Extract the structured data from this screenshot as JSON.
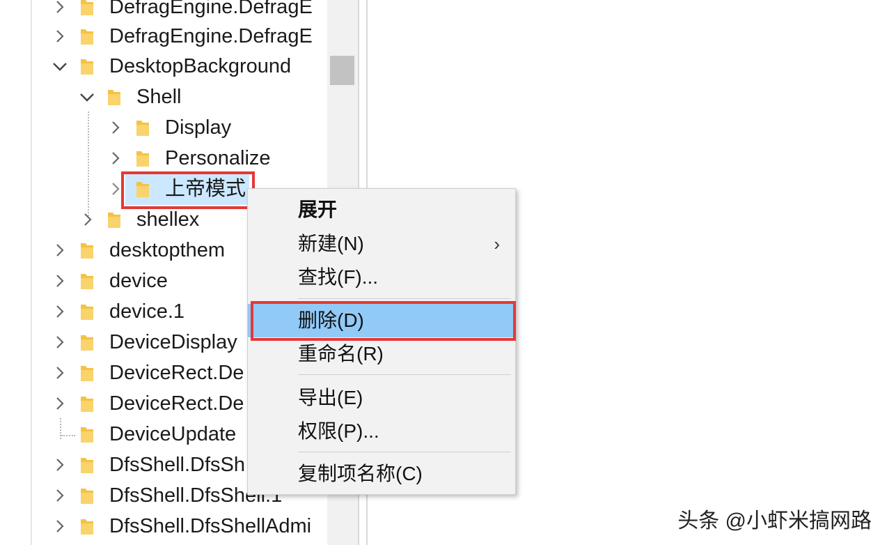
{
  "tree": {
    "items": [
      {
        "label": "DefragEngine.DefragE",
        "chevron": "right"
      },
      {
        "label": "DefragEngine.DefragE",
        "chevron": "right"
      },
      {
        "label": "DesktopBackground",
        "chevron": "down"
      },
      {
        "label": "Shell",
        "chevron": "down"
      },
      {
        "label": "Display",
        "chevron": "right"
      },
      {
        "label": "Personalize",
        "chevron": "right"
      },
      {
        "label": "上帝模式",
        "chevron": "right"
      },
      {
        "label": "shellex",
        "chevron": "right"
      },
      {
        "label": "desktopthem",
        "chevron": "right"
      },
      {
        "label": "device",
        "chevron": "right"
      },
      {
        "label": "device.1",
        "chevron": "right"
      },
      {
        "label": "DeviceDisplay",
        "chevron": "right"
      },
      {
        "label": "DeviceRect.De",
        "chevron": "right"
      },
      {
        "label": "DeviceRect.De",
        "chevron": "right"
      },
      {
        "label": "DeviceUpdate",
        "chevron": "none"
      },
      {
        "label": "DfsShell.DfsSh",
        "chevron": "right"
      },
      {
        "label": "DfsShell.DfsShell.1",
        "chevron": "right"
      },
      {
        "label": "DfsShell.DfsShellAdmi",
        "chevron": "right"
      }
    ]
  },
  "context_menu": {
    "items": [
      {
        "label": "展开"
      },
      {
        "label": "新建(N)",
        "submenu_arrow": "›"
      },
      {
        "label": "查找(F)..."
      },
      {
        "label": "删除(D)"
      },
      {
        "label": "重命名(R)"
      },
      {
        "label": "导出(E)"
      },
      {
        "label": "权限(P)..."
      },
      {
        "label": "复制项名称(C)"
      }
    ]
  },
  "watermark": "头条 @小虾米搞网路",
  "colors": {
    "folder": "#f5c242",
    "selection": "#cce8ff",
    "menu_highlight": "#91c9f7",
    "annotation_red": "#e53935"
  }
}
